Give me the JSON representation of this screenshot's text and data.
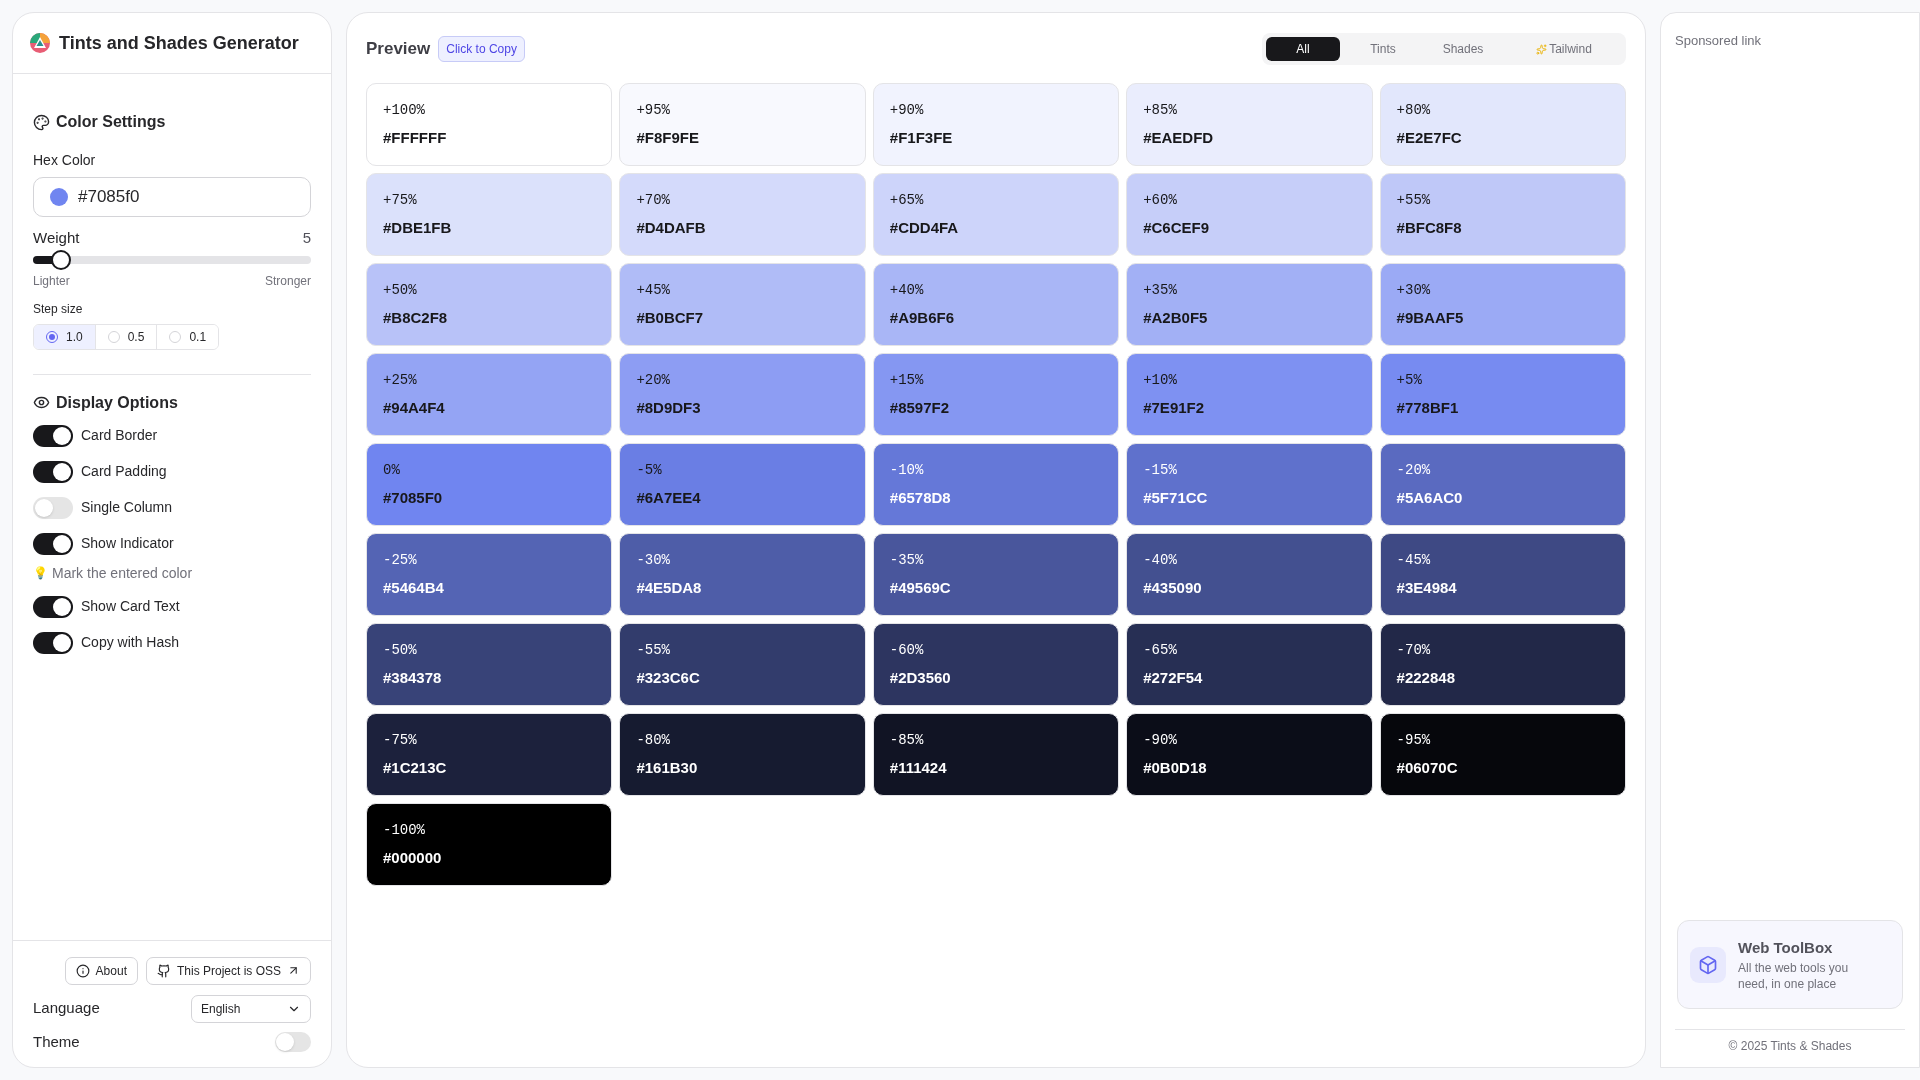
{
  "app": {
    "title": "Tints and Shades Generator"
  },
  "color_settings": {
    "title": "Color Settings",
    "hex_label": "Hex Color",
    "hex_value": "#7085f0",
    "weight_label": "Weight",
    "weight_value": "5",
    "weight": {
      "level": 0.1
    },
    "lighter": "Lighter",
    "stronger": "Stronger",
    "step_label": "Step size",
    "steps": [
      {
        "label": "1.0",
        "selected": true
      },
      {
        "label": "0.5",
        "selected": false
      },
      {
        "label": "0.1",
        "selected": false
      }
    ]
  },
  "display_options": {
    "title": "Display Options",
    "items": [
      {
        "kind": "toggle",
        "label": "Card Border",
        "on": true
      },
      {
        "kind": "toggle",
        "label": "Card Padding",
        "on": true
      },
      {
        "kind": "toggle",
        "label": "Single Column",
        "on": false
      },
      {
        "kind": "toggle",
        "label": "Show Indicator",
        "on": true
      },
      {
        "kind": "hint",
        "icon": "💡",
        "label": "Mark the entered color"
      },
      {
        "kind": "toggle",
        "label": "Show Card Text",
        "on": true
      },
      {
        "kind": "toggle",
        "label": "Copy with Hash",
        "on": true
      }
    ]
  },
  "footer": {
    "buttons": [
      {
        "kind": "info",
        "label": "About"
      },
      {
        "kind": "github",
        "label": "This Project is OSS"
      }
    ],
    "language_label": "Language",
    "language_value": "English",
    "theme_label": "Theme",
    "theme_on": false
  },
  "preview": {
    "title": "Preview",
    "badge": "Click to Copy",
    "tabs": [
      {
        "kind": "plain",
        "label": "All",
        "selected": true
      },
      {
        "kind": "plain",
        "label": "Tints",
        "selected": false
      },
      {
        "kind": "plain",
        "label": "Shades",
        "selected": false
      },
      {
        "kind": "sparkle",
        "label": "Tailwind",
        "selected": false
      }
    ],
    "swatches": [
      {
        "label": "+100%",
        "hex": "#FFFFFF",
        "color": "#ffffff"
      },
      {
        "label": "+95%",
        "hex": "#F8F9FE",
        "color": "#f8f9fe"
      },
      {
        "label": "+90%",
        "hex": "#F1F3FE",
        "color": "#f1f3fe"
      },
      {
        "label": "+85%",
        "hex": "#EAEDFD",
        "color": "#eaedfd"
      },
      {
        "label": "+80%",
        "hex": "#E2E7FC",
        "color": "#e2e7fc"
      },
      {
        "label": "+75%",
        "hex": "#DBE1FB",
        "color": "#dbe1fb"
      },
      {
        "label": "+70%",
        "hex": "#D4DAFB",
        "color": "#d4dafb"
      },
      {
        "label": "+65%",
        "hex": "#CDD4FA",
        "color": "#cdd4fa"
      },
      {
        "label": "+60%",
        "hex": "#C6CEF9",
        "color": "#c6cef9"
      },
      {
        "label": "+55%",
        "hex": "#BFC8F8",
        "color": "#bfc8f8"
      },
      {
        "label": "+50%",
        "hex": "#B8C2F8",
        "color": "#b8c2f8"
      },
      {
        "label": "+45%",
        "hex": "#B0BCF7",
        "color": "#b0bcf7"
      },
      {
        "label": "+40%",
        "hex": "#A9B6F6",
        "color": "#a9b6f6"
      },
      {
        "label": "+35%",
        "hex": "#A2B0F5",
        "color": "#a2b0f5"
      },
      {
        "label": "+30%",
        "hex": "#9BAAF5",
        "color": "#9baaf5"
      },
      {
        "label": "+25%",
        "hex": "#94A4F4",
        "color": "#94a4f4"
      },
      {
        "label": "+20%",
        "hex": "#8D9DF3",
        "color": "#8d9df3"
      },
      {
        "label": "+15%",
        "hex": "#8597F2",
        "color": "#8597f2"
      },
      {
        "label": "+10%",
        "hex": "#7E91F2",
        "color": "#7e91f2"
      },
      {
        "label": "+5%",
        "hex": "#778BF1",
        "color": "#778bf1"
      },
      {
        "label": "0%",
        "hex": "#7085F0",
        "color": "#7085f0"
      },
      {
        "label": "-5%",
        "hex": "#6A7EE4",
        "color": "#6a7ee4"
      },
      {
        "label": "-10%",
        "hex": "#6578D8",
        "color": "#6578d8"
      },
      {
        "label": "-15%",
        "hex": "#5F71CC",
        "color": "#5f71cc"
      },
      {
        "label": "-20%",
        "hex": "#5A6AC0",
        "color": "#5a6ac0"
      },
      {
        "label": "-25%",
        "hex": "#5464B4",
        "color": "#5464b4"
      },
      {
        "label": "-30%",
        "hex": "#4E5DA8",
        "color": "#4e5da8"
      },
      {
        "label": "-35%",
        "hex": "#49569C",
        "color": "#49569c"
      },
      {
        "label": "-40%",
        "hex": "#435090",
        "color": "#435090"
      },
      {
        "label": "-45%",
        "hex": "#3E4984",
        "color": "#3e4984"
      },
      {
        "label": "-50%",
        "hex": "#384378",
        "color": "#384378"
      },
      {
        "label": "-55%",
        "hex": "#323C6C",
        "color": "#323c6c"
      },
      {
        "label": "-60%",
        "hex": "#2D3560",
        "color": "#2d3560"
      },
      {
        "label": "-65%",
        "hex": "#272F54",
        "color": "#272f54"
      },
      {
        "label": "-70%",
        "hex": "#222848",
        "color": "#222848"
      },
      {
        "label": "-75%",
        "hex": "#1C213C",
        "color": "#1c213c"
      },
      {
        "label": "-80%",
        "hex": "#161B30",
        "color": "#161b30"
      },
      {
        "label": "-85%",
        "hex": "#111424",
        "color": "#111424"
      },
      {
        "label": "-90%",
        "hex": "#0B0D18",
        "color": "#0b0d18"
      },
      {
        "label": "-95%",
        "hex": "#06070C",
        "color": "#06070c"
      },
      {
        "label": "-100%",
        "hex": "#000000",
        "color": "#000000"
      }
    ]
  },
  "sidebar_right": {
    "sponsored": "Sponsored link",
    "promo_title": "Web ToolBox",
    "promo_text": "All the web tools you need, in one place",
    "copyright": "© 2025 Tints & Shades"
  }
}
